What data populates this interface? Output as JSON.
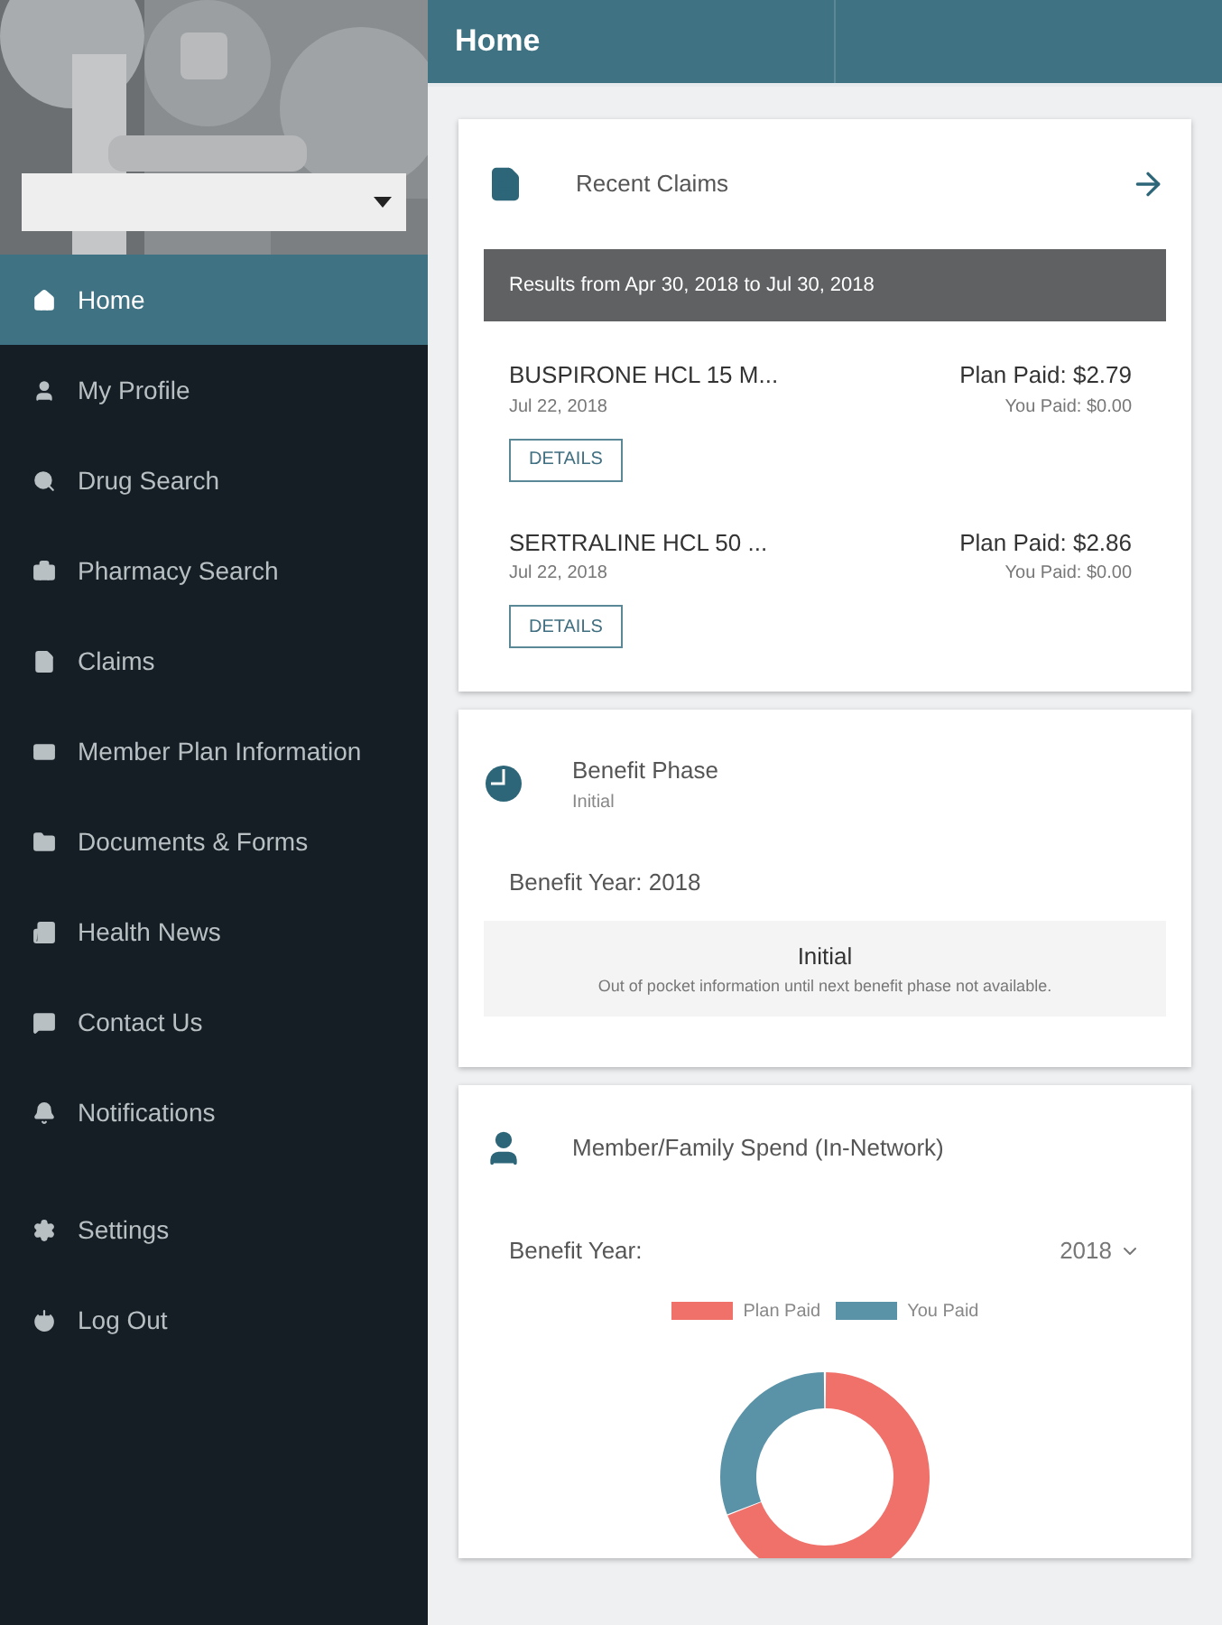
{
  "sidebar": {
    "nav_items": [
      {
        "label": "Home",
        "selected": true
      },
      {
        "label": "My Profile",
        "selected": false
      },
      {
        "label": "Drug Search",
        "selected": false
      },
      {
        "label": "Pharmacy Search",
        "selected": false
      },
      {
        "label": "Claims",
        "selected": false
      },
      {
        "label": "Member Plan Information",
        "selected": false
      },
      {
        "label": "Documents & Forms",
        "selected": false
      },
      {
        "label": "Health News",
        "selected": false
      },
      {
        "label": "Contact Us",
        "selected": false
      },
      {
        "label": "Notifications",
        "selected": false
      }
    ],
    "footer_items": [
      {
        "label": "Settings",
        "selected": false
      },
      {
        "label": "Log Out",
        "selected": false
      }
    ]
  },
  "top_bar": {
    "title": "Home"
  },
  "recent_claims": {
    "title": "Recent Claims",
    "range": "Results from Apr 30, 2018 to Jul 30, 2018",
    "claims": [
      {
        "drug": "BUSPIRONE HCL 15 M...",
        "date": "Jul 22, 2018",
        "plan_paid": "Plan Paid: $2.79",
        "you_paid": "You Paid: $0.00",
        "button": "DETAILS"
      },
      {
        "drug": "SERTRALINE HCL 50 ...",
        "date": "Jul 22, 2018",
        "plan_paid": "Plan Paid: $2.86",
        "you_paid": "You Paid: $0.00",
        "button": "DETAILS"
      }
    ]
  },
  "benefit_phase": {
    "title": "Benefit Phase",
    "subtitle": "Initial",
    "year": "Benefit Year: 2018",
    "phase": "Initial",
    "note": "Out of pocket information until next benefit phase not available."
  },
  "family_spend": {
    "title": "Member/Family Spend (In-Network)",
    "year_label": "Benefit Year:",
    "year_value": "2018",
    "legend": [
      {
        "label": "Plan Paid",
        "color": "#f0706a"
      },
      {
        "label": "You Paid",
        "color": "#5a93a8"
      }
    ]
  }
}
